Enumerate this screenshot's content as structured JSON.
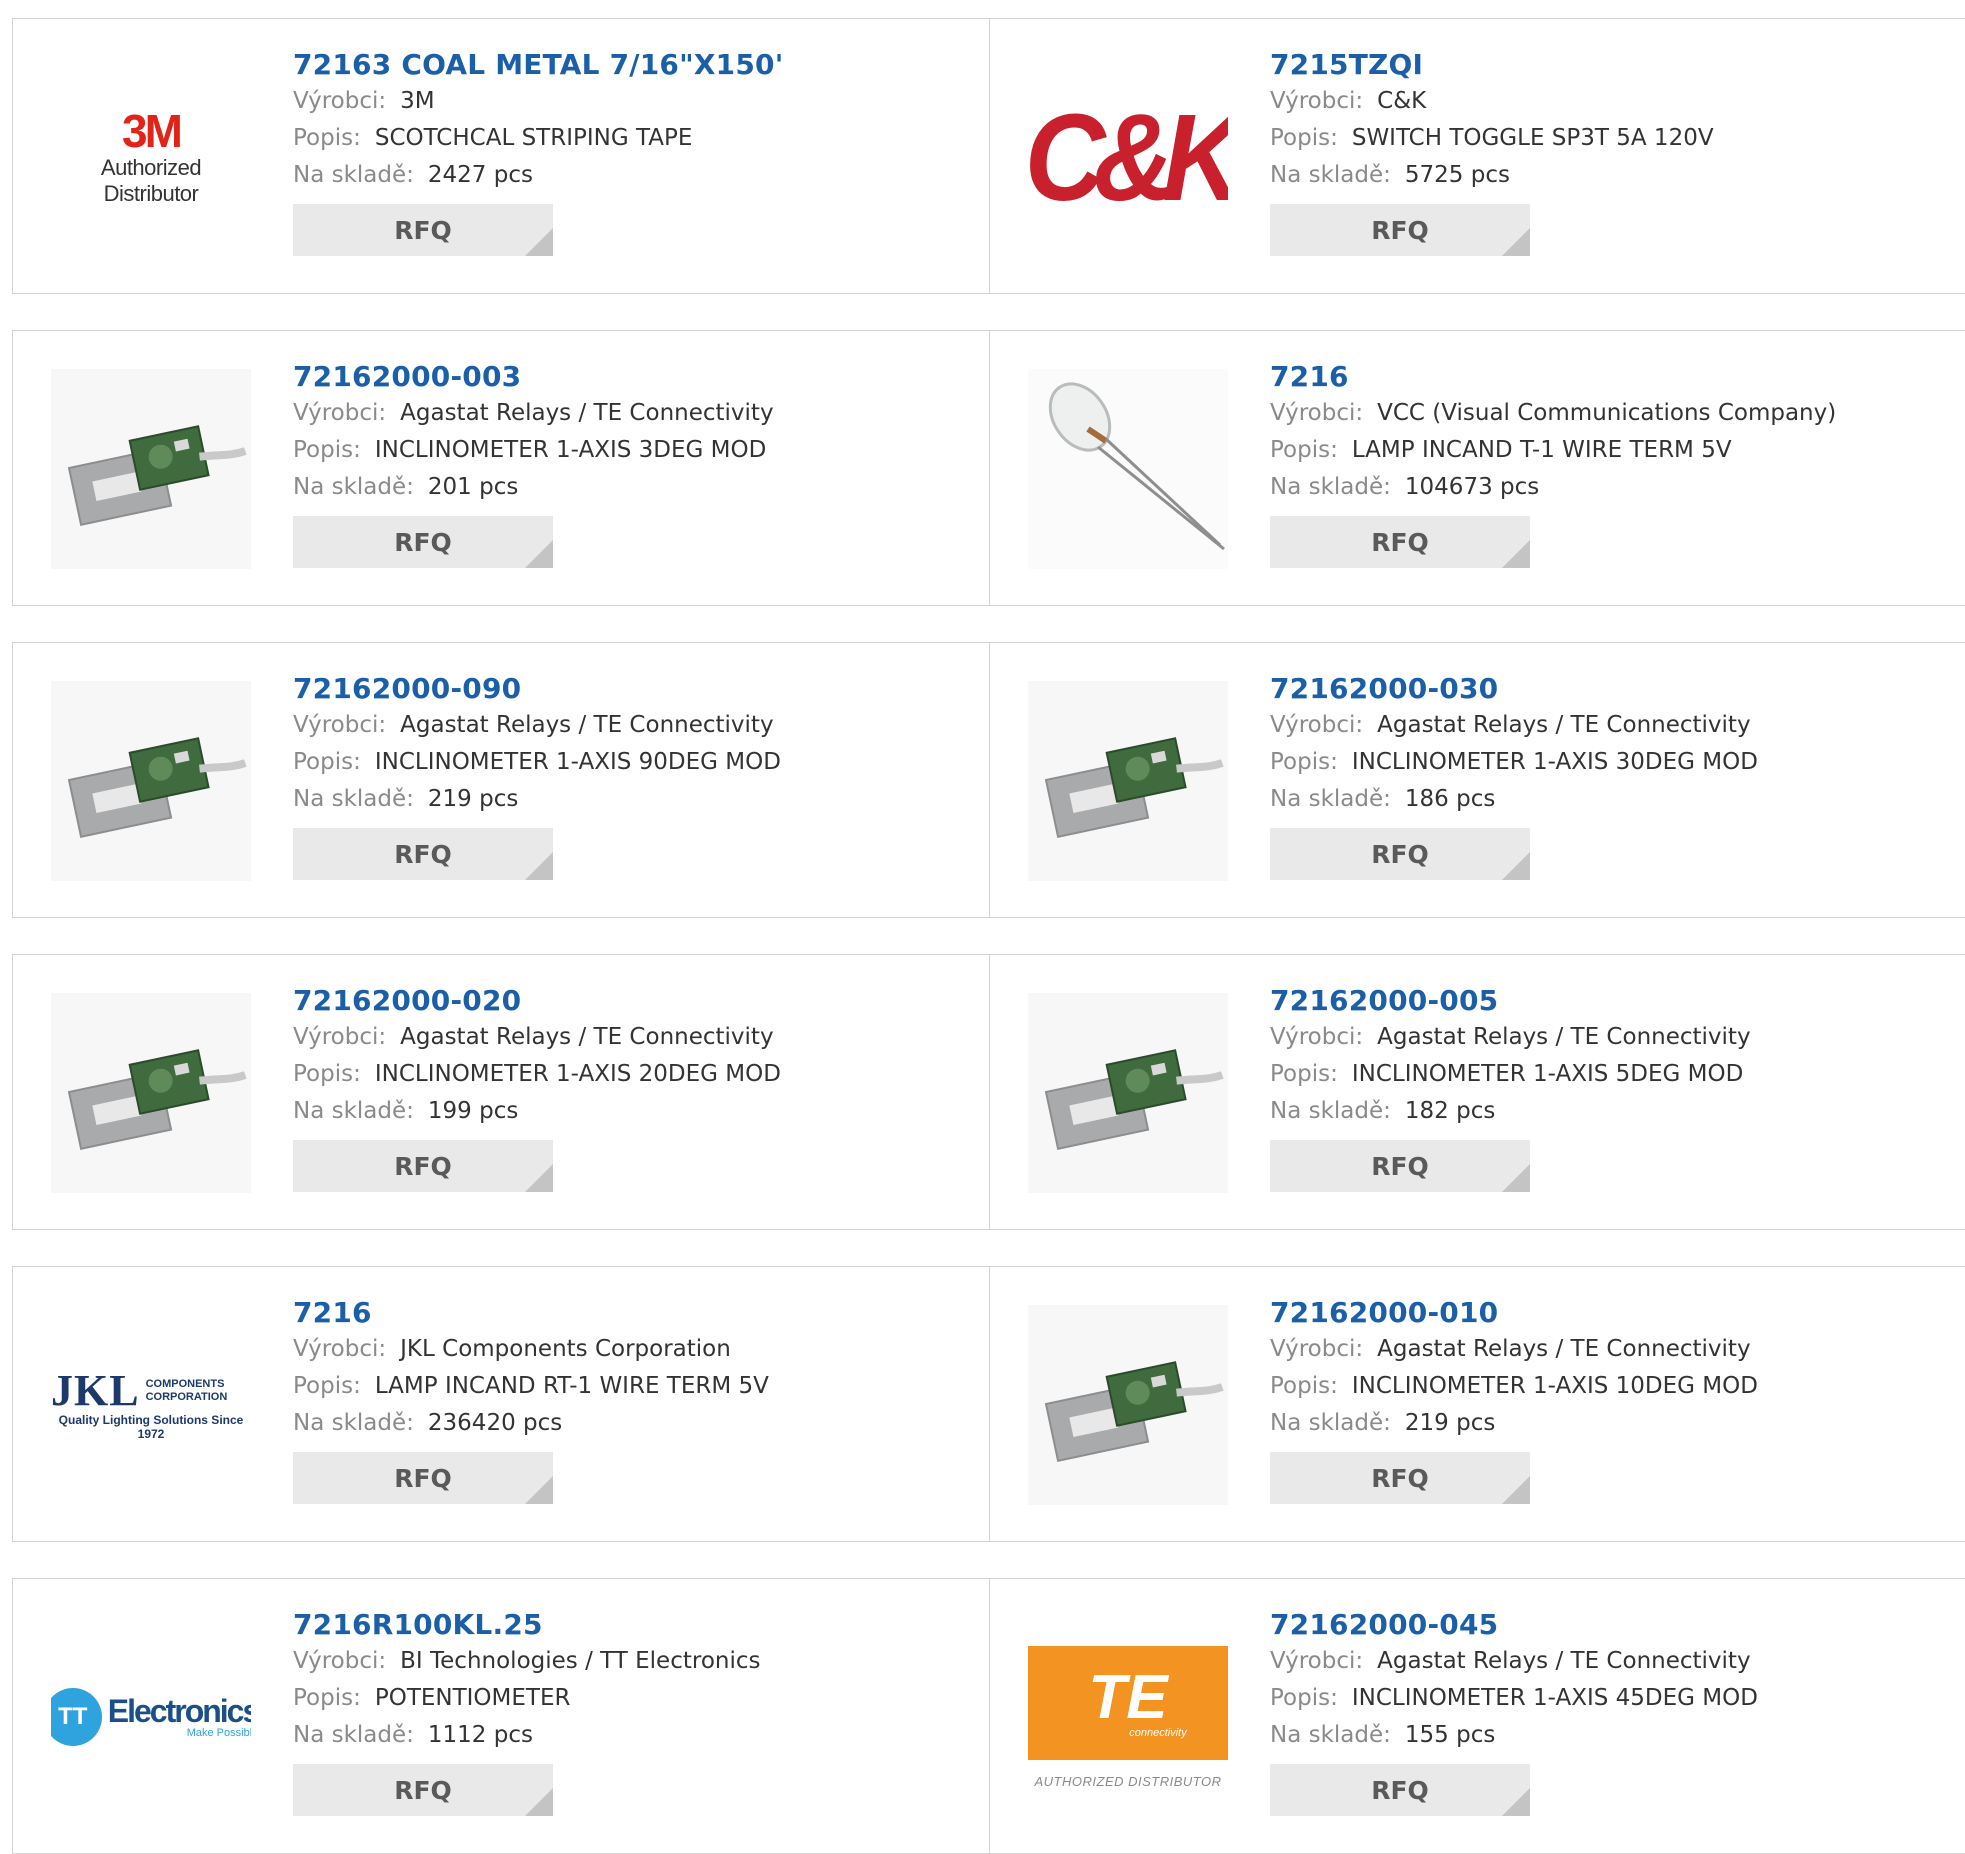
{
  "labels": {
    "manufacturer": "Výrobci:",
    "description": "Popis:",
    "stock": "Na skladě:",
    "rfq": "RFQ"
  },
  "products": [
    {
      "part": "72163 COAL METAL 7/16\"X150'",
      "manufacturer": "3M",
      "description": "SCOTCHCAL STRIPING TAPE",
      "stock": "2427 pcs",
      "image": "3m-logo",
      "logo_text": "3M",
      "logo_subtext": "Authorized Distributor"
    },
    {
      "part": "7215TZQI",
      "manufacturer": "C&K",
      "description": "SWITCH TOGGLE SP3T 5A 120V",
      "stock": "5725 pcs",
      "image": "ck-logo",
      "logo_text": "C&K"
    },
    {
      "part": "72162000-003",
      "manufacturer": "Agastat Relays / TE Connectivity",
      "description": "INCLINOMETER 1-AXIS 3DEG MOD",
      "stock": "201 pcs",
      "image": "inclinometer-photo"
    },
    {
      "part": "7216",
      "manufacturer": "VCC (Visual Communications Company)",
      "description": "LAMP INCAND T-1 WIRE TERM 5V",
      "stock": "104673 pcs",
      "image": "lamp-photo"
    },
    {
      "part": "72162000-090",
      "manufacturer": "Agastat Relays / TE Connectivity",
      "description": "INCLINOMETER 1-AXIS 90DEG MOD",
      "stock": "219 pcs",
      "image": "inclinometer-photo"
    },
    {
      "part": "72162000-030",
      "manufacturer": "Agastat Relays / TE Connectivity",
      "description": "INCLINOMETER 1-AXIS 30DEG MOD",
      "stock": "186 pcs",
      "image": "inclinometer-photo"
    },
    {
      "part": "72162000-020",
      "manufacturer": "Agastat Relays / TE Connectivity",
      "description": "INCLINOMETER 1-AXIS 20DEG MOD",
      "stock": "199 pcs",
      "image": "inclinometer-photo"
    },
    {
      "part": "72162000-005",
      "manufacturer": "Agastat Relays / TE Connectivity",
      "description": "INCLINOMETER 1-AXIS 5DEG MOD",
      "stock": "182 pcs",
      "image": "inclinometer-photo"
    },
    {
      "part": "7216",
      "manufacturer": "JKL Components Corporation",
      "description": "LAMP INCAND RT-1 WIRE TERM 5V",
      "stock": "236420 pcs",
      "image": "jkl-logo",
      "logo_text": "JKL",
      "logo_subtext": "COMPONENTS CORPORATION",
      "logo_tagline": "Quality Lighting Solutions Since 1972"
    },
    {
      "part": "72162000-010",
      "manufacturer": "Agastat Relays / TE Connectivity",
      "description": "INCLINOMETER 1-AXIS 10DEG MOD",
      "stock": "219 pcs",
      "image": "inclinometer-photo"
    },
    {
      "part": "7216R100KL.25",
      "manufacturer": "BI Technologies / TT Electronics",
      "description": "POTENTIOMETER",
      "stock": "1112 pcs",
      "image": "tt-electronics-logo",
      "logo_text": "Electronics",
      "logo_mark": "TT",
      "logo_tagline": "Make Possible"
    },
    {
      "part": "72162000-045",
      "manufacturer": "Agastat Relays / TE Connectivity",
      "description": "INCLINOMETER 1-AXIS 45DEG MOD",
      "stock": "155 pcs",
      "image": "te-connectivity-logo",
      "logo_text": "TE",
      "logo_subtext": "connectivity",
      "logo_tagline": "AUTHORIZED DISTRIBUTOR"
    }
  ],
  "colors": {
    "link": "#1a5fa8",
    "label": "#8a8a8a",
    "value": "#333333",
    "button_bg": "#e9e9e9",
    "border": "#d4d4d4"
  }
}
